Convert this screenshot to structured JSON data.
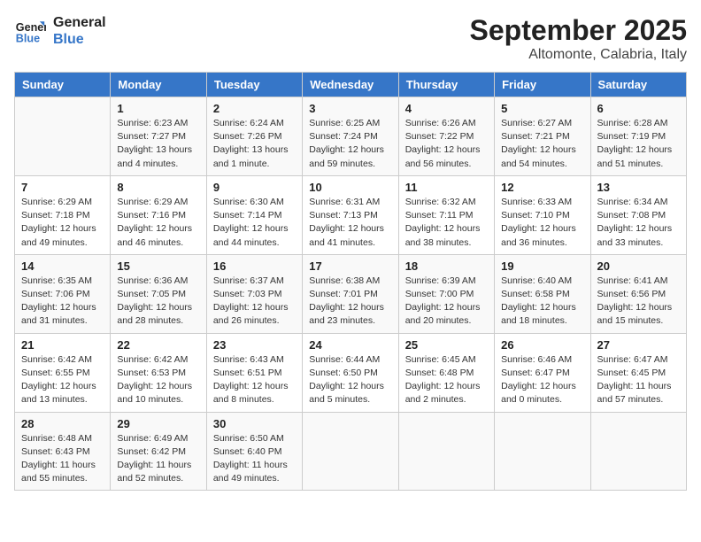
{
  "header": {
    "logo_line1": "General",
    "logo_line2": "Blue",
    "month": "September 2025",
    "location": "Altomonte, Calabria, Italy"
  },
  "days_of_week": [
    "Sunday",
    "Monday",
    "Tuesday",
    "Wednesday",
    "Thursday",
    "Friday",
    "Saturday"
  ],
  "weeks": [
    [
      {
        "day": "",
        "info": ""
      },
      {
        "day": "1",
        "info": "Sunrise: 6:23 AM\nSunset: 7:27 PM\nDaylight: 13 hours\nand 4 minutes."
      },
      {
        "day": "2",
        "info": "Sunrise: 6:24 AM\nSunset: 7:26 PM\nDaylight: 13 hours\nand 1 minute."
      },
      {
        "day": "3",
        "info": "Sunrise: 6:25 AM\nSunset: 7:24 PM\nDaylight: 12 hours\nand 59 minutes."
      },
      {
        "day": "4",
        "info": "Sunrise: 6:26 AM\nSunset: 7:22 PM\nDaylight: 12 hours\nand 56 minutes."
      },
      {
        "day": "5",
        "info": "Sunrise: 6:27 AM\nSunset: 7:21 PM\nDaylight: 12 hours\nand 54 minutes."
      },
      {
        "day": "6",
        "info": "Sunrise: 6:28 AM\nSunset: 7:19 PM\nDaylight: 12 hours\nand 51 minutes."
      }
    ],
    [
      {
        "day": "7",
        "info": "Sunrise: 6:29 AM\nSunset: 7:18 PM\nDaylight: 12 hours\nand 49 minutes."
      },
      {
        "day": "8",
        "info": "Sunrise: 6:29 AM\nSunset: 7:16 PM\nDaylight: 12 hours\nand 46 minutes."
      },
      {
        "day": "9",
        "info": "Sunrise: 6:30 AM\nSunset: 7:14 PM\nDaylight: 12 hours\nand 44 minutes."
      },
      {
        "day": "10",
        "info": "Sunrise: 6:31 AM\nSunset: 7:13 PM\nDaylight: 12 hours\nand 41 minutes."
      },
      {
        "day": "11",
        "info": "Sunrise: 6:32 AM\nSunset: 7:11 PM\nDaylight: 12 hours\nand 38 minutes."
      },
      {
        "day": "12",
        "info": "Sunrise: 6:33 AM\nSunset: 7:10 PM\nDaylight: 12 hours\nand 36 minutes."
      },
      {
        "day": "13",
        "info": "Sunrise: 6:34 AM\nSunset: 7:08 PM\nDaylight: 12 hours\nand 33 minutes."
      }
    ],
    [
      {
        "day": "14",
        "info": "Sunrise: 6:35 AM\nSunset: 7:06 PM\nDaylight: 12 hours\nand 31 minutes."
      },
      {
        "day": "15",
        "info": "Sunrise: 6:36 AM\nSunset: 7:05 PM\nDaylight: 12 hours\nand 28 minutes."
      },
      {
        "day": "16",
        "info": "Sunrise: 6:37 AM\nSunset: 7:03 PM\nDaylight: 12 hours\nand 26 minutes."
      },
      {
        "day": "17",
        "info": "Sunrise: 6:38 AM\nSunset: 7:01 PM\nDaylight: 12 hours\nand 23 minutes."
      },
      {
        "day": "18",
        "info": "Sunrise: 6:39 AM\nSunset: 7:00 PM\nDaylight: 12 hours\nand 20 minutes."
      },
      {
        "day": "19",
        "info": "Sunrise: 6:40 AM\nSunset: 6:58 PM\nDaylight: 12 hours\nand 18 minutes."
      },
      {
        "day": "20",
        "info": "Sunrise: 6:41 AM\nSunset: 6:56 PM\nDaylight: 12 hours\nand 15 minutes."
      }
    ],
    [
      {
        "day": "21",
        "info": "Sunrise: 6:42 AM\nSunset: 6:55 PM\nDaylight: 12 hours\nand 13 minutes."
      },
      {
        "day": "22",
        "info": "Sunrise: 6:42 AM\nSunset: 6:53 PM\nDaylight: 12 hours\nand 10 minutes."
      },
      {
        "day": "23",
        "info": "Sunrise: 6:43 AM\nSunset: 6:51 PM\nDaylight: 12 hours\nand 8 minutes."
      },
      {
        "day": "24",
        "info": "Sunrise: 6:44 AM\nSunset: 6:50 PM\nDaylight: 12 hours\nand 5 minutes."
      },
      {
        "day": "25",
        "info": "Sunrise: 6:45 AM\nSunset: 6:48 PM\nDaylight: 12 hours\nand 2 minutes."
      },
      {
        "day": "26",
        "info": "Sunrise: 6:46 AM\nSunset: 6:47 PM\nDaylight: 12 hours\nand 0 minutes."
      },
      {
        "day": "27",
        "info": "Sunrise: 6:47 AM\nSunset: 6:45 PM\nDaylight: 11 hours\nand 57 minutes."
      }
    ],
    [
      {
        "day": "28",
        "info": "Sunrise: 6:48 AM\nSunset: 6:43 PM\nDaylight: 11 hours\nand 55 minutes."
      },
      {
        "day": "29",
        "info": "Sunrise: 6:49 AM\nSunset: 6:42 PM\nDaylight: 11 hours\nand 52 minutes."
      },
      {
        "day": "30",
        "info": "Sunrise: 6:50 AM\nSunset: 6:40 PM\nDaylight: 11 hours\nand 49 minutes."
      },
      {
        "day": "",
        "info": ""
      },
      {
        "day": "",
        "info": ""
      },
      {
        "day": "",
        "info": ""
      },
      {
        "day": "",
        "info": ""
      }
    ]
  ]
}
